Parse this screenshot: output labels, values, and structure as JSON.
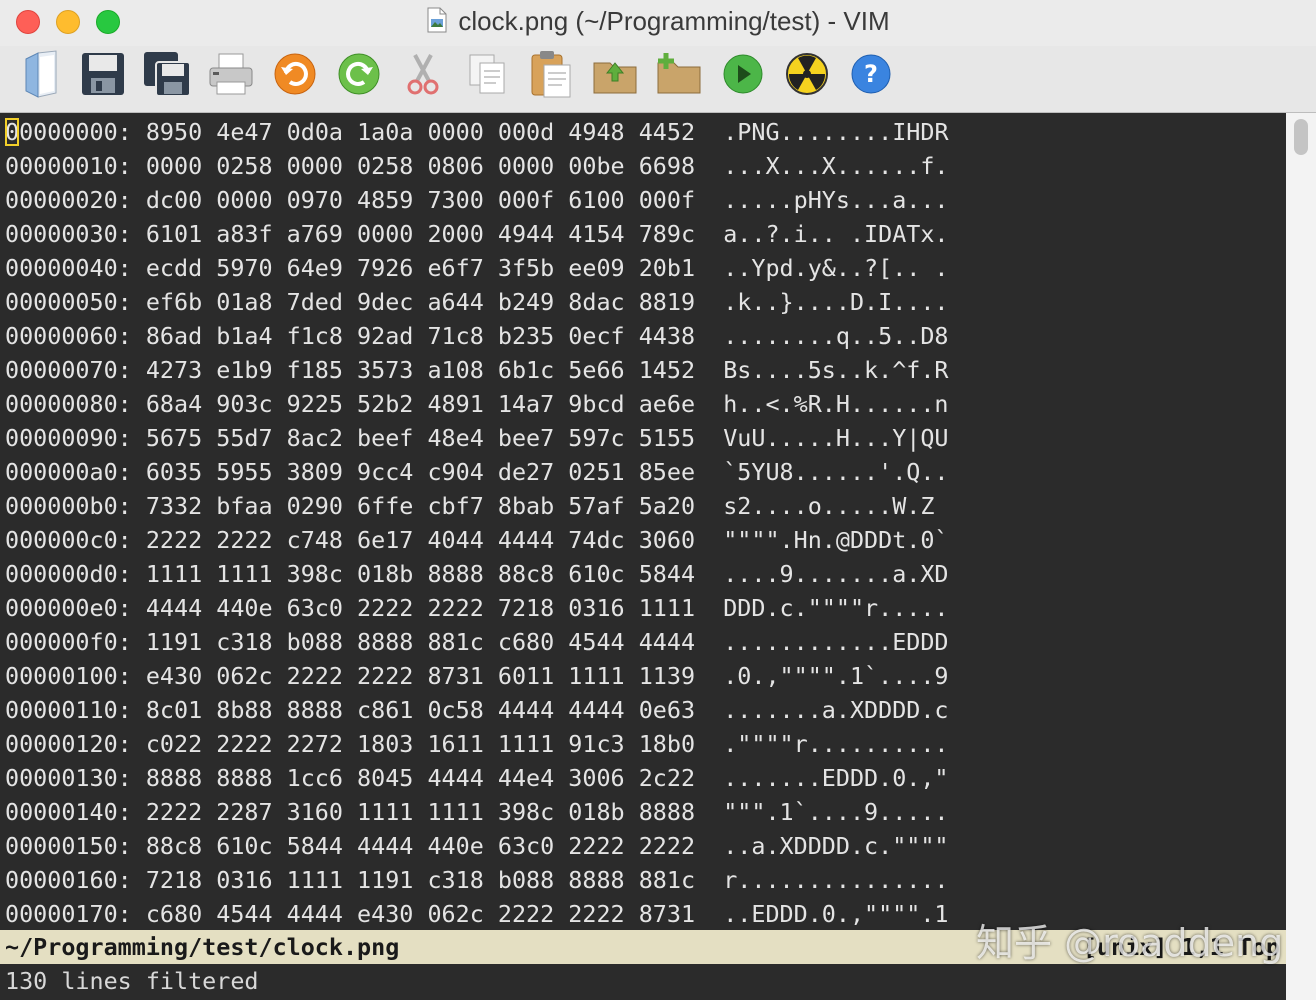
{
  "window": {
    "title": "clock.png (~/Programming/test) - VIM",
    "colors": {
      "background": "#2b2b2b",
      "text": "#e4e4e4",
      "cursor": "#f2cf2a",
      "statusline": "#e4dfc2"
    }
  },
  "toolbar": {
    "buttons": [
      {
        "icon": "open-file-icon"
      },
      {
        "icon": "save-icon"
      },
      {
        "icon": "save-all-icon"
      },
      {
        "icon": "print-icon"
      },
      {
        "icon": "undo-icon"
      },
      {
        "icon": "redo-icon"
      },
      {
        "icon": "cut-icon"
      },
      {
        "icon": "copy-icon"
      },
      {
        "icon": "paste-icon"
      },
      {
        "icon": "load-session-icon"
      },
      {
        "icon": "save-session-icon"
      },
      {
        "icon": "run-icon"
      },
      {
        "icon": "make-icon"
      },
      {
        "icon": "help-icon"
      }
    ]
  },
  "editor": {
    "lines": [
      "00000000: 8950 4e47 0d0a 1a0a 0000 000d 4948 4452  .PNG........IHDR",
      "00000010: 0000 0258 0000 0258 0806 0000 00be 6698  ...X...X......f.",
      "00000020: dc00 0000 0970 4859 7300 000f 6100 000f  .....pHYs...a...",
      "00000030: 6101 a83f a769 0000 2000 4944 4154 789c  a..?.i.. .IDATx.",
      "00000040: ecdd 5970 64e9 7926 e6f7 3f5b ee09 20b1  ..Ypd.y&..?[.. .",
      "00000050: ef6b 01a8 7ded 9dec a644 b249 8dac 8819  .k..}....D.I....",
      "00000060: 86ad b1a4 f1c8 92ad 71c8 b235 0ecf 4438  ........q..5..D8",
      "00000070: 4273 e1b9 f185 3573 a108 6b1c 5e66 1452  Bs....5s..k.^f.R",
      "00000080: 68a4 903c 9225 52b2 4891 14a7 9bcd ae6e  h..<.%R.H......n",
      "00000090: 5675 55d7 8ac2 beef 48e4 bee7 597c 5155  VuU.....H...Y|QU",
      "000000a0: 6035 5955 3809 9cc4 c904 de27 0251 85ee  `5YU8......'.Q..",
      "000000b0: 7332 bfaa 0290 6ffe cbf7 8bab 57af 5a20  s2....o.....W.Z ",
      "000000c0: 2222 2222 c748 6e17 4044 4444 74dc 3060  \"\"\"\".Hn.@DDDt.0`",
      "000000d0: 1111 1111 398c 018b 8888 88c8 610c 5844  ....9.......a.XD",
      "000000e0: 4444 440e 63c0 2222 2222 7218 0316 1111  DDD.c.\"\"\"\"r.....",
      "000000f0: 1191 c318 b088 8888 881c c680 4544 4444  ............EDDD",
      "00000100: e430 062c 2222 2222 8731 6011 1111 1139  .0.,\"\"\"\".1`....9",
      "00000110: 8c01 8b88 8888 c861 0c58 4444 4444 0e63  .......a.XDDDD.c",
      "00000120: c022 2222 2272 1803 1611 1111 91c3 18b0  .\"\"\"\"r..........",
      "00000130: 8888 8888 1cc6 8045 4444 44e4 3006 2c22  .......EDDD.0.,\"",
      "00000140: 2222 2287 3160 1111 1111 398c 018b 8888  \"\"\".1`....9.....",
      "00000150: 88c8 610c 5844 4444 440e 63c0 2222 2222  ..a.XDDDD.c.\"\"\"\"",
      "00000160: 7218 0316 1111 1191 c318 b088 8888 881c  r...............",
      "00000170: c680 4544 4444 e430 062c 2222 2222 8731  ..EDDD.0.,\"\"\"\".1"
    ]
  },
  "statusline": {
    "filename": "~/Programming/test/clock.png",
    "position": "[unix] 1,1   Top"
  },
  "cmdline": {
    "message": "130 lines filtered"
  },
  "watermark": {
    "text": "知乎 @roaddeng"
  }
}
